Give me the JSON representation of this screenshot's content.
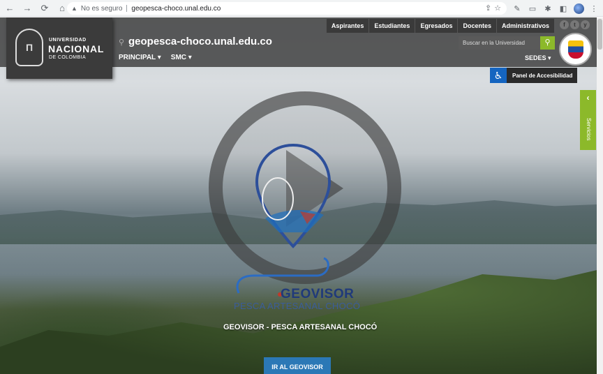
{
  "browser": {
    "security_label": "No es seguro",
    "url": "geopesca-choco.unal.edu.co"
  },
  "header": {
    "top_nav": [
      "Aspirantes",
      "Estudiantes",
      "Egresados",
      "Docentes",
      "Administrativos"
    ],
    "logo": {
      "line1": "UNIVERSIDAD",
      "line2": "NACIONAL",
      "line3": "DE COLOMBIA"
    },
    "site_title": "geopesca-choco.unal.edu.co",
    "main_nav": [
      "PRINCIPAL ▾",
      "SMC ▾"
    ],
    "search_placeholder": "Buscar en la Universidad",
    "sedes_label": "SEDES ▾",
    "social": [
      "f",
      "t",
      "y"
    ]
  },
  "accessibility": {
    "label": "Panel de Accesibilidad"
  },
  "side_tab": {
    "label": "Servicios"
  },
  "hero": {
    "brand": "GEOVISOR",
    "brand_sub": "PESCA ARTESANAL CHOCÓ",
    "caption": "GEOVISOR - PESCA ARTESANAL CHOCÓ",
    "cta_label": "IR AL GEOVISOR"
  }
}
